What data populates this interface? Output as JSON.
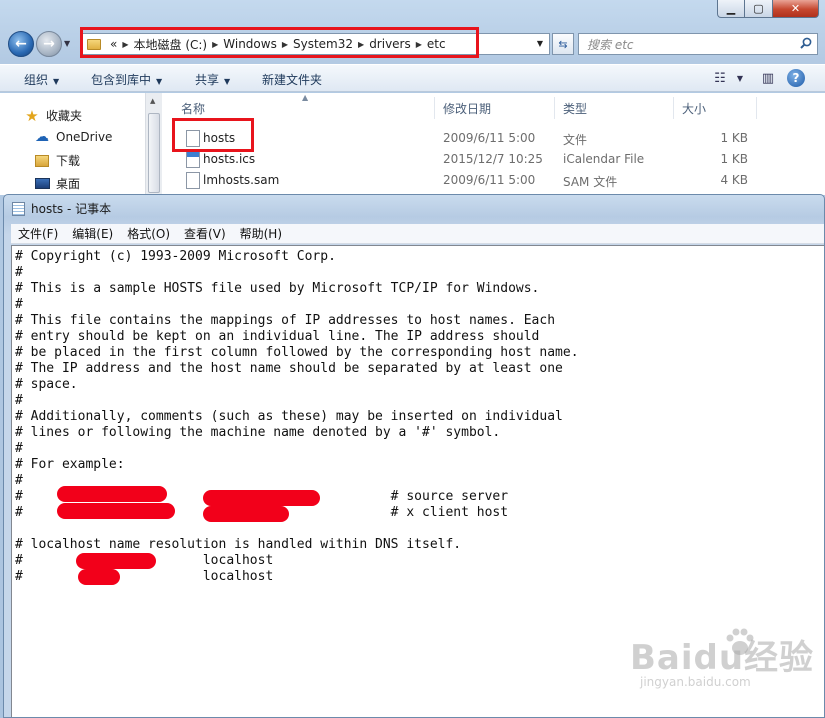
{
  "explorer": {
    "address": {
      "overflow": "«",
      "crumbs": [
        "本地磁盘 (C:)",
        "Windows",
        "System32",
        "drivers",
        "etc"
      ]
    },
    "search_placeholder": "搜索 etc",
    "toolbar": {
      "organize": "组织",
      "include_library": "包含到库中",
      "share": "共享",
      "new_folder": "新建文件夹"
    },
    "nav": {
      "favorites": "收藏夹",
      "onedrive": "OneDrive",
      "downloads": "下载",
      "desktop": "桌面"
    },
    "columns": {
      "name": "名称",
      "date": "修改日期",
      "type": "类型",
      "size": "大小"
    },
    "files": [
      {
        "name": "hosts",
        "date": "2009/6/11 5:00",
        "type": "文件",
        "size": "1 KB"
      },
      {
        "name": "hosts.ics",
        "date": "2015/12/7 10:25",
        "type": "iCalendar File",
        "size": "1 KB"
      },
      {
        "name": "lmhosts.sam",
        "date": "2009/6/11 5:00",
        "type": "SAM 文件",
        "size": "4 KB"
      }
    ]
  },
  "notepad": {
    "title": "hosts - 记事本",
    "menu": {
      "file": "文件(F)",
      "edit": "编辑(E)",
      "format": "格式(O)",
      "view": "查看(V)",
      "help": "帮助(H)"
    },
    "lines": [
      "# Copyright (c) 1993-2009 Microsoft Corp.",
      "#",
      "# This is a sample HOSTS file used by Microsoft TCP/IP for Windows.",
      "#",
      "# This file contains the mappings of IP addresses to host names. Each",
      "# entry should be kept on an individual line. The IP address should",
      "# be placed in the first column followed by the corresponding host name.",
      "# The IP address and the host name should be separated by at least one",
      "# space.",
      "#",
      "# Additionally, comments (such as these) may be inserted on individual",
      "# lines or following the machine name denoted by a '#' symbol.",
      "#",
      "# For example:",
      "#",
      "#                                               # source server",
      "#                                               # x client host",
      "",
      "# localhost name resolution is handled within DNS itself.",
      "#                       localhost",
      "#                       localhost"
    ]
  },
  "watermark": {
    "logo": "Baidu经验",
    "url": "jingyan.baidu.com"
  },
  "colors": {
    "highlight": "#e8141c",
    "redaction": "#f2001a"
  }
}
